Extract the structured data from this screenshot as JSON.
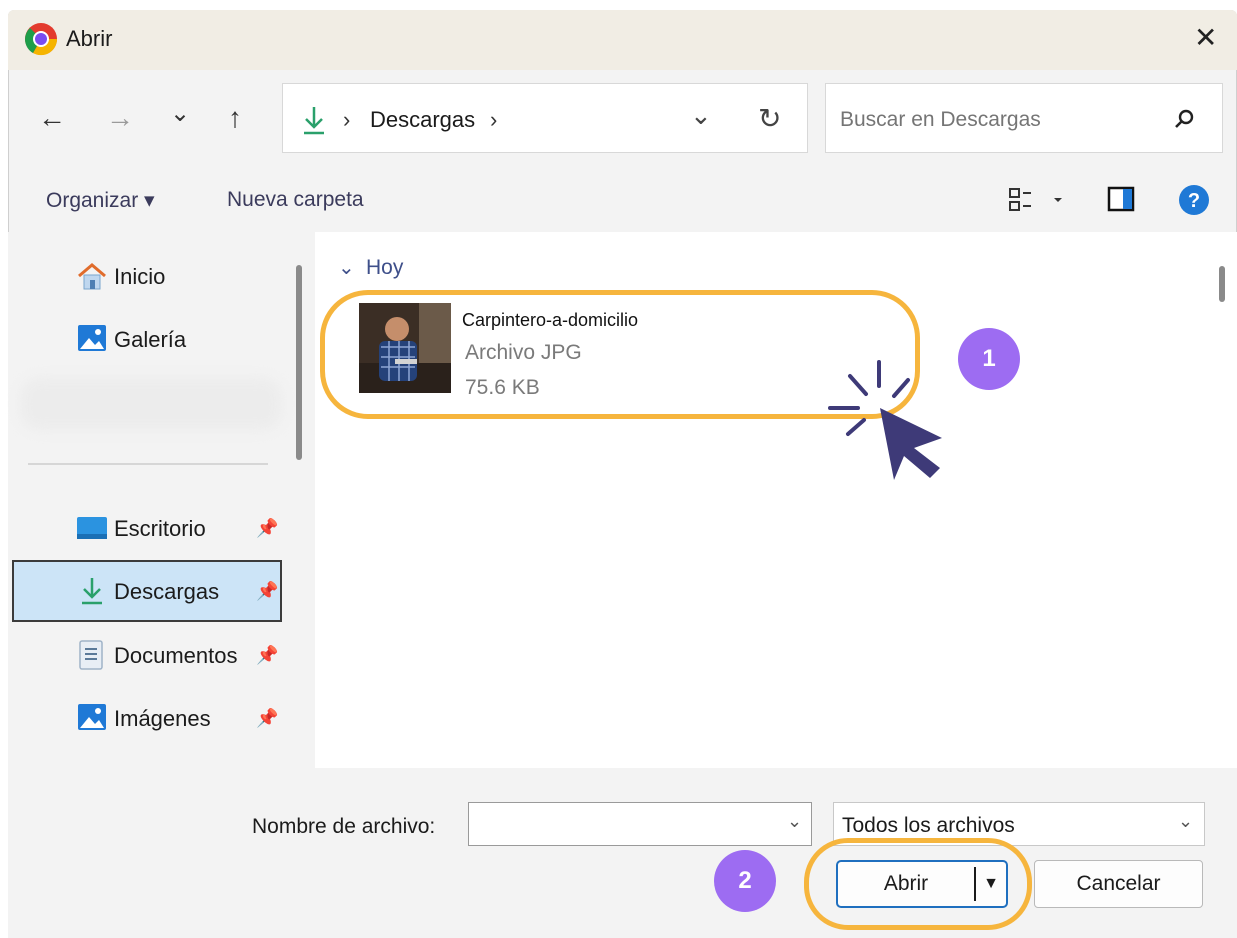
{
  "window": {
    "title": "Abrir"
  },
  "toolbar": {
    "back": "←",
    "forward": "→",
    "recent": "⌄",
    "up": "↑",
    "path_sep1": "›",
    "path_folder": "Descargas",
    "path_sep2": "›",
    "path_dropdown": "⌄",
    "refresh": "↻",
    "search_placeholder": "Buscar en Descargas"
  },
  "commands": {
    "organize": "Organizar ▾",
    "new_folder": "Nueva carpeta"
  },
  "sidebar": {
    "items": [
      {
        "label": "Inicio"
      },
      {
        "label": "Galería"
      },
      {
        "label": "Escritorio"
      },
      {
        "label": "Descargas"
      },
      {
        "label": "Documentos"
      },
      {
        "label": "Imágenes"
      }
    ]
  },
  "content": {
    "group": "Hoy",
    "files": [
      {
        "name": "Carpintero-a-domicilio",
        "type": "Archivo JPG",
        "size": "75.6 KB"
      }
    ]
  },
  "footer": {
    "filename_label": "Nombre de archivo:",
    "filename_value": "",
    "filter": "Todos los archivos",
    "open": "Abrir",
    "cancel": "Cancelar"
  },
  "annotations": {
    "step1": "1",
    "step2": "2"
  },
  "colors": {
    "highlight": "#f6b53d",
    "badge": "#9d6cf2",
    "cursor": "#3e3a78",
    "accent": "#0067c0"
  }
}
